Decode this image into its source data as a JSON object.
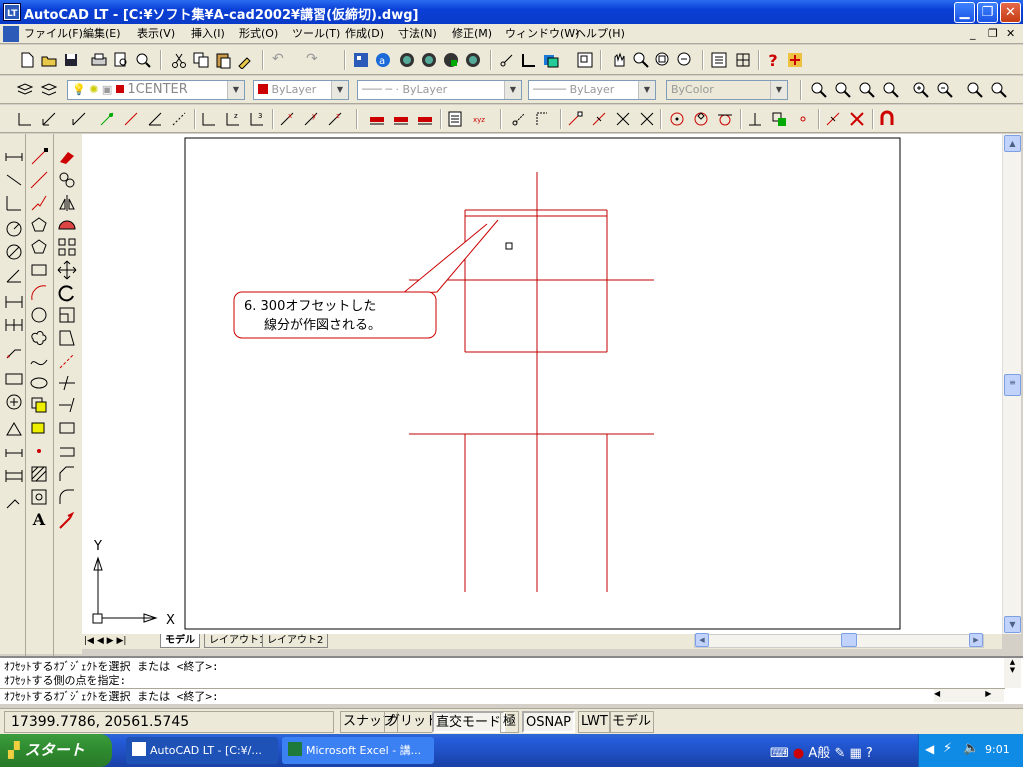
{
  "window": {
    "title": "AutoCAD LT - [C:¥ソフト集¥A-cad2002¥講習(仮締切).dwg]",
    "min_icon": "minimize-icon",
    "max_icon": "maximize-icon",
    "close_icon": "close-icon"
  },
  "menu": {
    "items": [
      {
        "label": "ファイル(F)"
      },
      {
        "label": "編集(E)"
      },
      {
        "label": "表示(V)"
      },
      {
        "label": "挿入(I)"
      },
      {
        "label": "形式(O)"
      },
      {
        "label": "ツール(T)"
      },
      {
        "label": "作成(D)"
      },
      {
        "label": "寸法(N)"
      },
      {
        "label": "修正(M)"
      },
      {
        "label": "ウィンドウ(W)"
      },
      {
        "label": "ヘルプ(H)"
      }
    ]
  },
  "properties": {
    "layer": "1CENTER",
    "color": "ByLayer",
    "linetype": "ByLayer",
    "lineweight": "ByLayer",
    "plotstyle": "ByColor"
  },
  "drawing": {
    "callout_line1": "6. 300オフセットした",
    "callout_line2": "線分が作図される。",
    "ucs_x": "X",
    "ucs_y": "Y",
    "line_color": "#c00000"
  },
  "tabs": [
    {
      "label": "モデル",
      "active": true
    },
    {
      "label": "レイアウト1",
      "active": false
    },
    {
      "label": "レイアウト2",
      "active": false
    }
  ],
  "command": {
    "line1": "ｵﾌｾｯﾄするｵﾌﾞｼﾞｪｸﾄを選択 または <終了>:",
    "line2": "ｵﾌｾｯﾄする側の点を指定:",
    "line3": "ｵﾌｾｯﾄするｵﾌﾞｼﾞｪｸﾄを選択 または <終了>:"
  },
  "status": {
    "coords": "17399.7786, 20561.5745",
    "modes": [
      {
        "label": "スナップ",
        "on": false
      },
      {
        "label": "グリッド",
        "on": false
      },
      {
        "label": "直交モード",
        "on": true
      },
      {
        "label": "極",
        "on": false
      },
      {
        "label": "OSNAP",
        "on": true
      },
      {
        "label": "LWT",
        "on": false
      },
      {
        "label": "モデル",
        "on": false
      }
    ]
  },
  "taskbar": {
    "start": "スタート",
    "tasks": [
      {
        "label": "AutoCAD LT - [C:¥/...",
        "active": true
      },
      {
        "label": "Microsoft Excel - 講...",
        "active": false
      }
    ],
    "ime": "A般",
    "clock": "9:01"
  }
}
